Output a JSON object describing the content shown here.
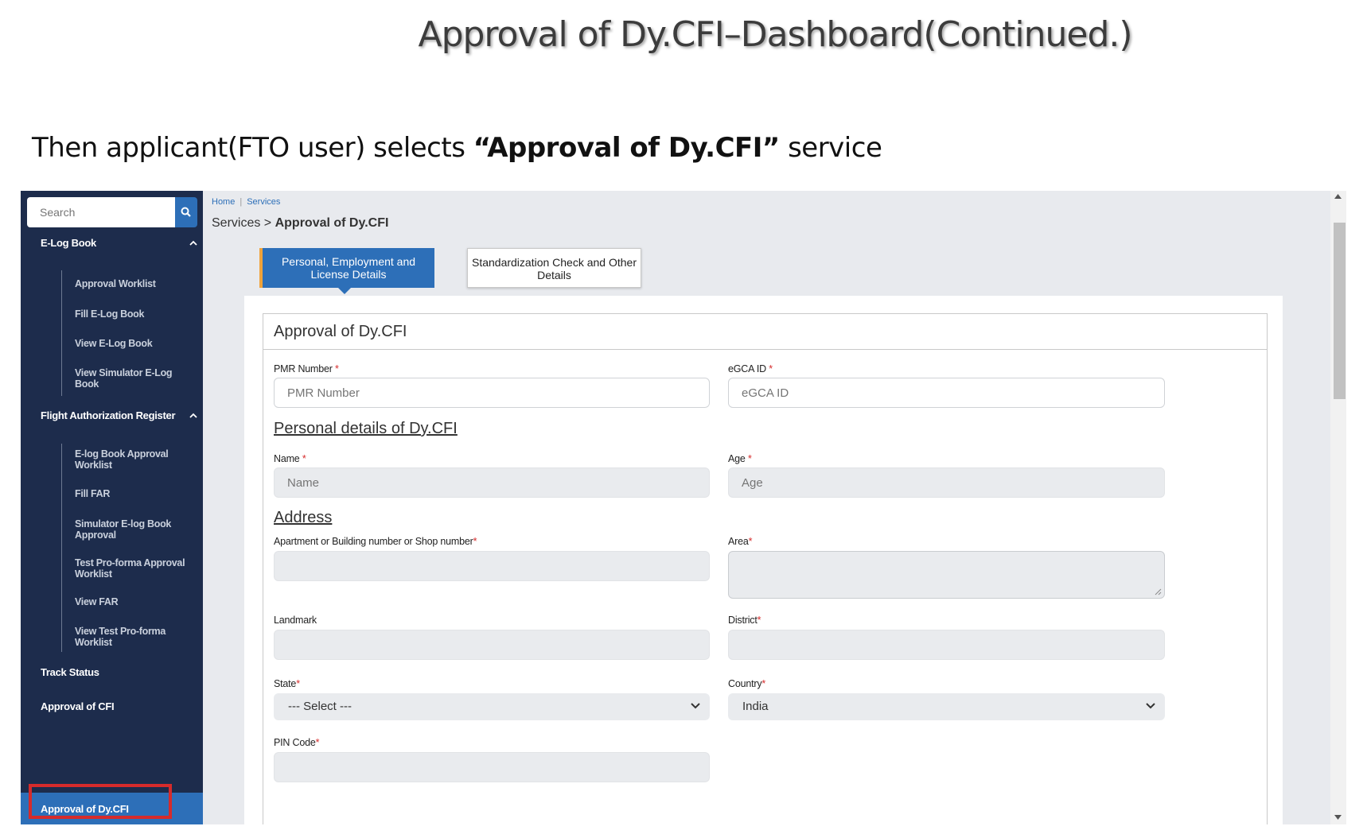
{
  "slide": {
    "title": "Approval of Dy.CFI–Dashboard(Continued.)",
    "intro_prefix": "Then applicant(FTO user) selects ",
    "intro_bold": "“Approval of Dy.CFI”",
    "intro_suffix": " service"
  },
  "sidebar": {
    "search_placeholder": "Search",
    "groups": [
      {
        "label": "E-Log Book",
        "items": [
          "Approval Worklist",
          "Fill E-Log Book",
          "View E-Log Book",
          "View Simulator E-Log Book"
        ]
      },
      {
        "label": "Flight Authorization Register",
        "items": [
          "E-log Book Approval Worklist",
          "Fill FAR",
          "Simulator E-log Book Approval",
          "Test Pro-forma Approval Worklist",
          "View FAR",
          "View Test Pro-forma Worklist"
        ]
      }
    ],
    "track_status": "Track Status",
    "approval_cfi": "Approval of CFI",
    "approval_dycfi": "Approval of Dy.CFI"
  },
  "breadcrumb": {
    "home": "Home",
    "services": "Services"
  },
  "path": {
    "prefix": "Services > ",
    "current": "Approval of Dy.CFI"
  },
  "tabs": [
    {
      "label": "Personal, Employment and License Details",
      "active": true
    },
    {
      "label": "Standardization Check and Other Details",
      "active": false
    }
  ],
  "form": {
    "title": "Approval of Dy.CFI",
    "pmr_label": "PMR Number",
    "pmr_placeholder": "PMR Number",
    "egca_label": "eGCA ID",
    "egca_placeholder": "eGCA ID",
    "personal_heading": "Personal details of Dy.CFI",
    "name_label": "Name",
    "name_placeholder": "Name",
    "age_label": "Age",
    "age_placeholder": "Age",
    "address_heading": "Address",
    "apartment_label": "Apartment or Building number or Shop number",
    "area_label": "Area",
    "landmark_label": "Landmark",
    "district_label": "District",
    "state_label": "State",
    "state_value": "--- Select ---",
    "country_label": "Country",
    "country_value": "India",
    "pin_label": "PIN Code",
    "required_mark": "*"
  },
  "colors": {
    "sidebar": "#1d2c4c",
    "accent": "#2d6fb8",
    "highlight": "#d62b2b",
    "tab_marker": "#f0a33a"
  }
}
